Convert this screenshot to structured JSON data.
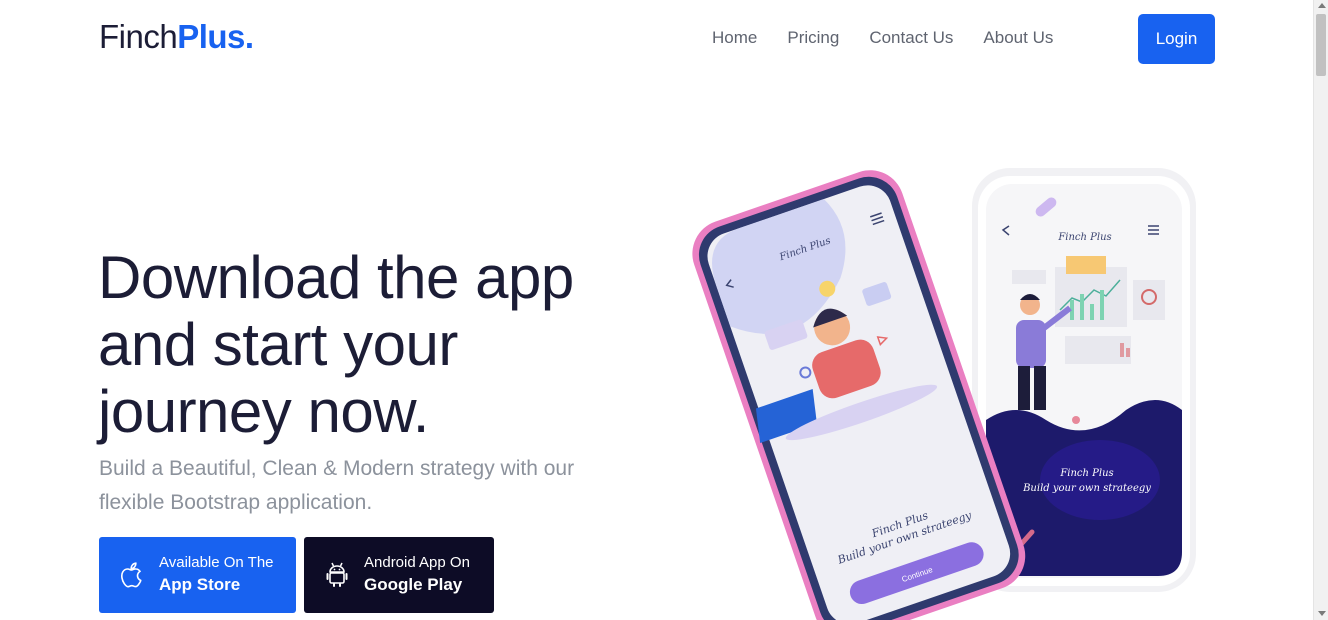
{
  "brand": {
    "part1": "Finch",
    "part2": "Plus."
  },
  "nav": {
    "items": [
      "Home",
      "Pricing",
      "Contact Us",
      "About Us"
    ],
    "login_label": "Login"
  },
  "hero": {
    "title_line1": "Download the app",
    "title_line2": "and start your",
    "title_line3": "journey now.",
    "subtitle_line1": "Build a Beautiful, Clean & Modern strategy with our",
    "subtitle_line2": "flexible Bootstrap application."
  },
  "store_buttons": {
    "apple": {
      "line1": "Available On The",
      "line2": "App Store",
      "icon": "apple-icon"
    },
    "android": {
      "line1": "Android App On",
      "line2": "Google Play",
      "icon": "android-icon"
    }
  },
  "phones": {
    "left": {
      "header": "Finch Plus",
      "tagline1": "Finch Plus",
      "tagline2": "Build your own strateegy",
      "button": "Continue"
    },
    "right": {
      "header": "Finch Plus",
      "tagline1": "Finch Plus",
      "tagline2": "Build your own strateegy"
    }
  },
  "colors": {
    "accent": "#1862f0",
    "dark": "#0d0c26",
    "heading": "#1c1d36",
    "muted": "#8c929c"
  }
}
